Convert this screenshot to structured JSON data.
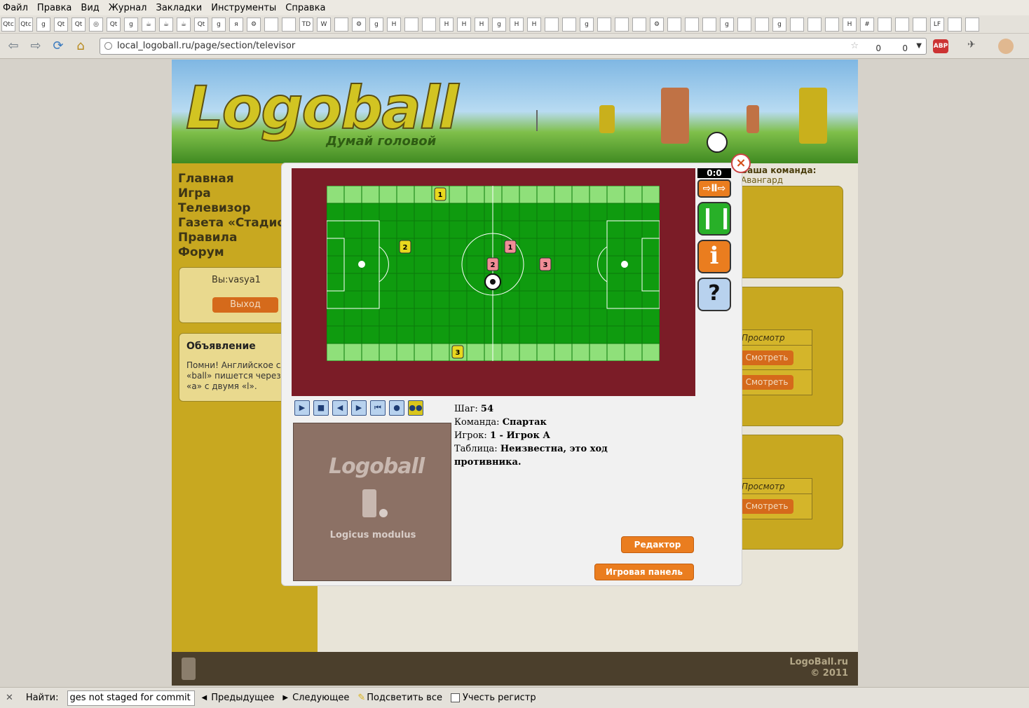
{
  "menu": [
    "Файл",
    "Правка",
    "Вид",
    "Журнал",
    "Закладки",
    "Инструменты",
    "Справка"
  ],
  "bookmarks": [
    "Qtc",
    "Qtc",
    "g",
    "Qt",
    "Qt",
    "◎",
    "Qt",
    "g",
    "☕",
    "☕",
    "☕",
    "Qt",
    "g",
    "я",
    "⚙",
    "",
    "",
    "TD",
    "W",
    "",
    "⚙",
    "g",
    "H",
    "",
    "",
    "H",
    "H",
    "H",
    "g",
    "H",
    "H",
    "",
    "",
    "g",
    "",
    "",
    "",
    "⚙",
    "",
    "",
    "",
    "g",
    "",
    "",
    "g",
    "",
    "",
    "",
    "H",
    "#",
    "",
    "",
    "",
    "LF",
    "",
    ""
  ],
  "url": "local_logoball.ru/page/section/televisor",
  "counters": {
    "g": "0",
    "ya": "0"
  },
  "site": {
    "logo": "Logoball",
    "slogan": "Думай головой",
    "menu": [
      "Главная",
      "Игра",
      "Телевизор",
      "Газета «Стадион»",
      "Правила",
      "Форум"
    ],
    "user": "Вы:vasya1",
    "logout": "Выход",
    "announce_title": "Объявление",
    "announce_text": "Помни! Английское слово «ball» пишется через букву «a» с двумя «l».",
    "team_label": "Ваша команда:",
    "team_name": "Авангард",
    "view_header": "Просмотр",
    "view_btn": "Смотреть",
    "footer_line1": "LogoBall.ru",
    "footer_line2": "© 2011"
  },
  "modal": {
    "close": "×",
    "score": "0:0",
    "step_label": "Шаг:",
    "step": "54",
    "team_label": "Команда:",
    "team": "Спартак",
    "player_label": "Игрок:",
    "player": "1 - Игрок А",
    "table_label": "Таблица:",
    "table": "Неизвестна, это ход противника.",
    "preview_logo": "Logoball",
    "preview_caption": "Logicus modulus",
    "editor_btn": "Редактор",
    "panel_btn": "Игровая панель"
  },
  "players": [
    {
      "team": "yellow",
      "num": "1"
    },
    {
      "team": "yellow",
      "num": "2"
    },
    {
      "team": "yellow",
      "num": "3"
    },
    {
      "team": "red",
      "num": "1"
    },
    {
      "team": "red",
      "num": "2"
    },
    {
      "team": "red",
      "num": "3"
    }
  ],
  "find": {
    "label": "Найти:",
    "value": "ges not staged for commit",
    "prev": "Предыдущее",
    "next": "Следующее",
    "highlight": "Подсветить все",
    "case": "Учесть регистр"
  },
  "colors": {
    "accent": "#d56a1b",
    "field": "#0f9b0f",
    "border": "#7b1c27"
  }
}
